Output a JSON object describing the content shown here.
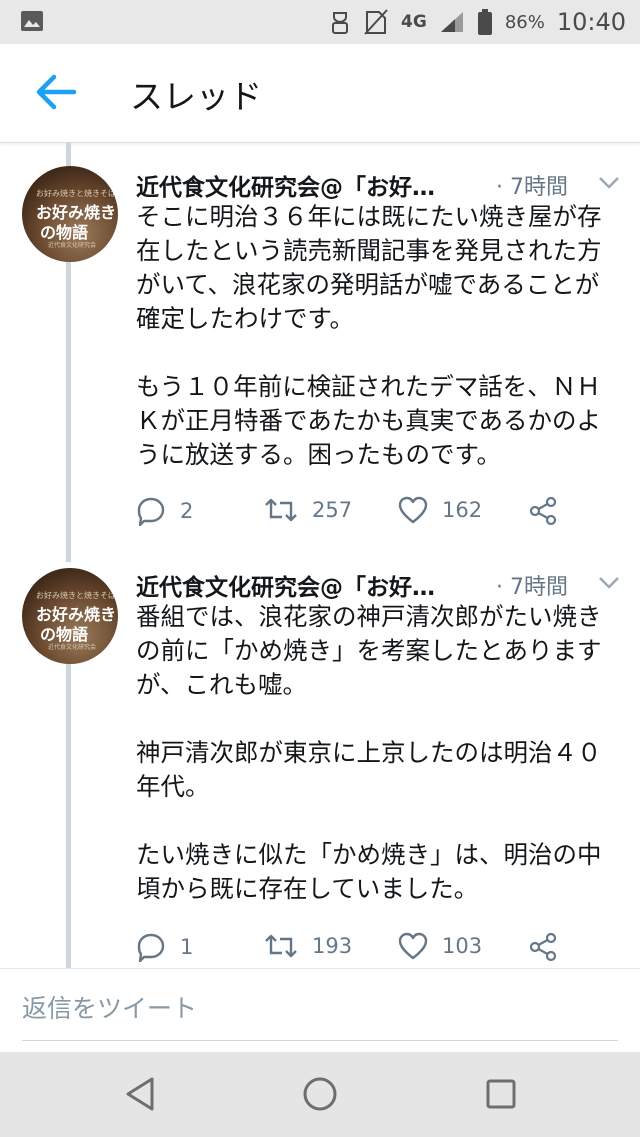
{
  "status_bar": {
    "network": "4G",
    "battery_percent": "86%",
    "time": "10:40"
  },
  "header": {
    "title": "スレッド"
  },
  "tweets": [
    {
      "author": "近代食文化研究会@「お好…",
      "time": "· 7時間",
      "avatar_text_top": "お好み焼きと焼きそば",
      "avatar_text_line1": "お好み焼き",
      "avatar_text_line2": "の物語",
      "avatar_text_sub": "近代食文化研究会",
      "text": "そこに明治３６年には既にたい焼き屋が存在したという読売新聞記事を発見された方がいて、浪花家の発明話が嘘であることが確定したわけです。\n\nもう１０年前に検証されたデマ話を、ＮＨＫが正月特番であたかも真実であるかのように放送する。困ったものです。",
      "replies": "2",
      "retweets": "257",
      "likes": "162"
    },
    {
      "author": "近代食文化研究会@「お好…",
      "time": "· 7時間",
      "avatar_text_top": "お好み焼きと焼きそば",
      "avatar_text_line1": "お好み焼き",
      "avatar_text_line2": "の物語",
      "avatar_text_sub": "近代食文化研究会",
      "text": "番組では、浪花家の神戸清次郎がたい焼きの前に「かめ焼き」を考案したとありますが、これも嘘。\n\n神戸清次郎が東京に上京したのは明治４０年代。\n\nたい焼きに似た「かめ焼き」は、明治の中頃から既に存在していました。",
      "replies": "1",
      "retweets": "193",
      "likes": "103"
    }
  ],
  "reply_bar": {
    "placeholder": "返信をツイート"
  },
  "icons": {
    "back": "arrow-left-icon",
    "reply": "reply-bubble-icon",
    "retweet": "retweet-icon",
    "like": "heart-icon",
    "share": "share-icon",
    "caret": "chevron-down-icon"
  },
  "colors": {
    "accent": "#1da1f2",
    "secondary_text": "#657786",
    "thread_line": "#ccd6dd"
  }
}
